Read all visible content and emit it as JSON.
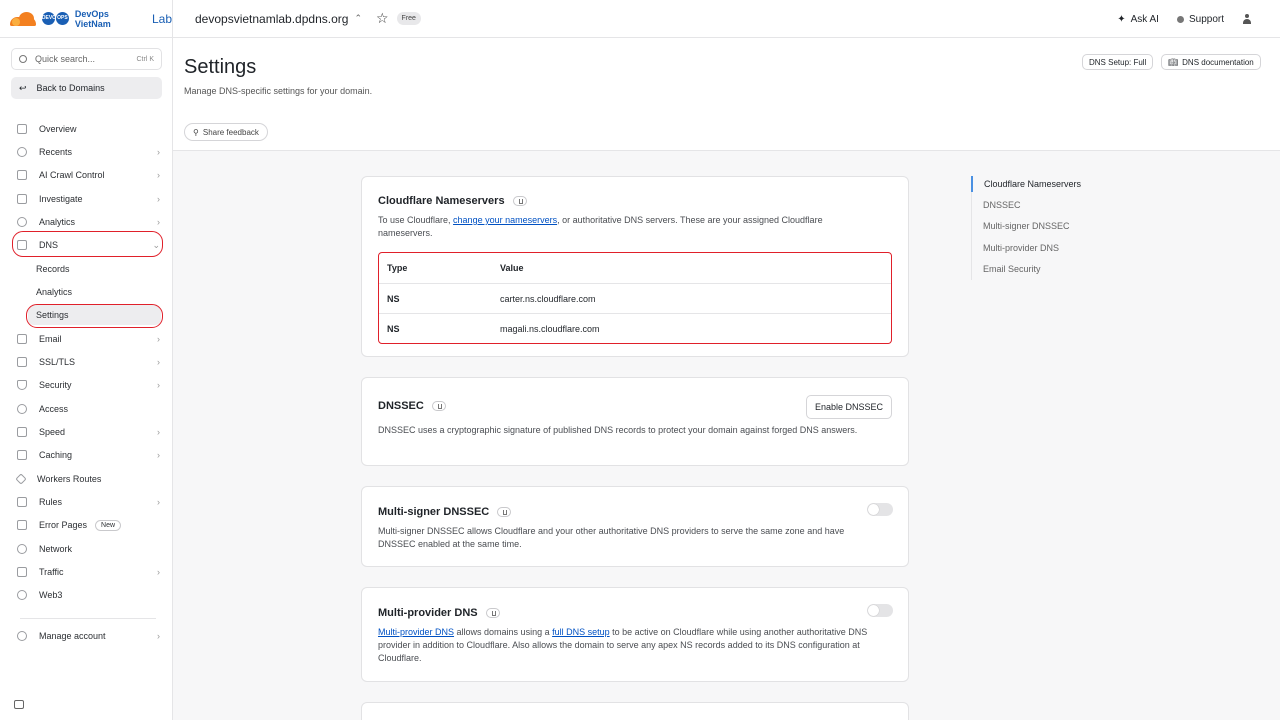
{
  "brand": {
    "badge_left": "DEVO",
    "badge_right": "OPS",
    "name": "DevOps VietNam",
    "suffix": "Lab"
  },
  "topbar": {
    "domain": "devopsvietnamlab.dpdns.org",
    "plan": "Free",
    "ask_ai": "Ask AI",
    "support": "Support"
  },
  "sidebar": {
    "search_placeholder": "Quick search...",
    "search_shortcut": "Ctrl K",
    "back": "Back to Domains",
    "items": [
      {
        "label": "Overview"
      },
      {
        "label": "Recents"
      },
      {
        "label": "AI Crawl Control"
      },
      {
        "label": "Investigate"
      },
      {
        "label": "Analytics"
      },
      {
        "label": "DNS"
      },
      {
        "label": "Email"
      },
      {
        "label": "SSL/TLS"
      },
      {
        "label": "Security"
      },
      {
        "label": "Access"
      },
      {
        "label": "Speed"
      },
      {
        "label": "Caching"
      },
      {
        "label": "Workers Routes"
      },
      {
        "label": "Rules"
      },
      {
        "label": "Error Pages",
        "badge": "New"
      },
      {
        "label": "Network"
      },
      {
        "label": "Traffic"
      },
      {
        "label": "Web3"
      },
      {
        "label": "Manage account"
      }
    ],
    "dns_sub": [
      "Records",
      "Analytics",
      "Settings"
    ]
  },
  "header": {
    "title": "Settings",
    "subtitle": "Manage DNS-specific settings for your domain.",
    "dns_setup": "DNS Setup: Full",
    "dns_docs": "DNS documentation",
    "feedback": "Share feedback"
  },
  "nameservers": {
    "title": "Cloudflare Nameservers",
    "desc_before": "To use Cloudflare, ",
    "desc_link": "change your nameservers",
    "desc_after": ", or authoritative DNS servers. These are your assigned Cloudflare nameservers.",
    "col_type": "Type",
    "col_value": "Value",
    "rows": [
      {
        "type": "NS",
        "value": "carter.ns.cloudflare.com"
      },
      {
        "type": "NS",
        "value": "magali.ns.cloudflare.com"
      }
    ]
  },
  "dnssec": {
    "title": "DNSSEC",
    "button": "Enable DNSSEC",
    "desc": "DNSSEC uses a cryptographic signature of published DNS records to protect your domain against forged DNS answers."
  },
  "multisigner": {
    "title": "Multi-signer DNSSEC",
    "desc": "Multi-signer DNSSEC allows Cloudflare and your other authoritative DNS providers to serve the same zone and have DNSSEC enabled at the same time."
  },
  "multiprovider": {
    "title": "Multi-provider DNS",
    "link1": "Multi-provider DNS",
    "text1": " allows domains using a ",
    "link2": "full DNS setup",
    "text2": " to be active on Cloudflare while using another authoritative DNS provider in addition to Cloudflare. Also allows the domain to serve any apex NS records added to its DNS configuration at Cloudflare."
  },
  "toc": [
    "Cloudflare Nameservers",
    "DNSSEC",
    "Multi-signer DNSSEC",
    "Multi-provider DNS",
    "Email Security"
  ]
}
